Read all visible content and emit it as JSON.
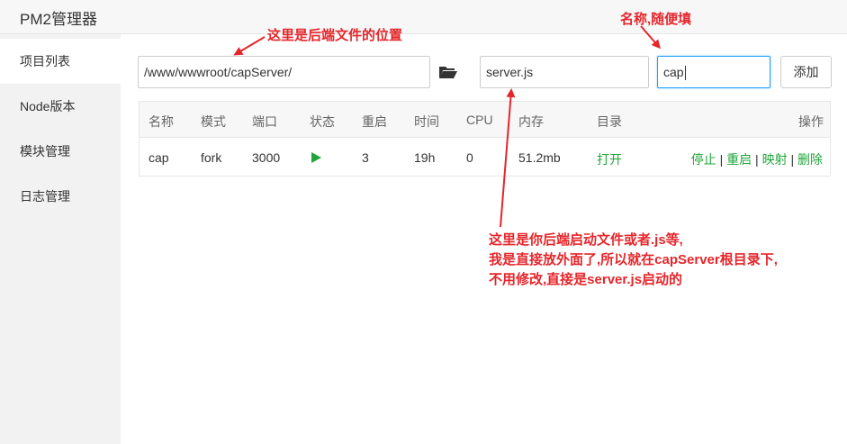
{
  "window": {
    "title": "PM2管理器"
  },
  "sidebar": {
    "items": [
      {
        "label": "项目列表",
        "active": true
      },
      {
        "label": "Node版本",
        "active": false
      },
      {
        "label": "模块管理",
        "active": false
      },
      {
        "label": "日志管理",
        "active": false
      }
    ]
  },
  "form": {
    "path_value": "/www/wwwroot/capServer/",
    "folder_icon": "folder-open-icon",
    "script_value": "server.js",
    "name_value": "cap",
    "add_label": "添加"
  },
  "table": {
    "headers": [
      "名称",
      "模式",
      "端口",
      "状态",
      "重启",
      "时间",
      "CPU",
      "内存",
      "目录",
      "操作"
    ],
    "rows": [
      {
        "name": "cap",
        "mode": "fork",
        "port": "3000",
        "status_icon": "play-icon",
        "restarts": "3",
        "uptime": "19h",
        "cpu": "0",
        "memory": "51.2mb",
        "dir_link": "打开",
        "ops": [
          "停止",
          "重启",
          "映射",
          "删除"
        ],
        "op_separator": " | "
      }
    ]
  },
  "annotations": {
    "path_note": "这里是后端文件的位置",
    "name_note": "名称,随便填",
    "script_note_lines": [
      "这里是你后端启动文件或者.js等,",
      "我是直接放外面了,所以就在capServer根目录下,",
      "不用修改,直接是server.js启动的"
    ],
    "color": "#e5262b"
  },
  "colors": {
    "accent_green": "#20a53a",
    "focus_blue": "#20a0ff",
    "sidebar_bg": "#f2f2f2"
  }
}
